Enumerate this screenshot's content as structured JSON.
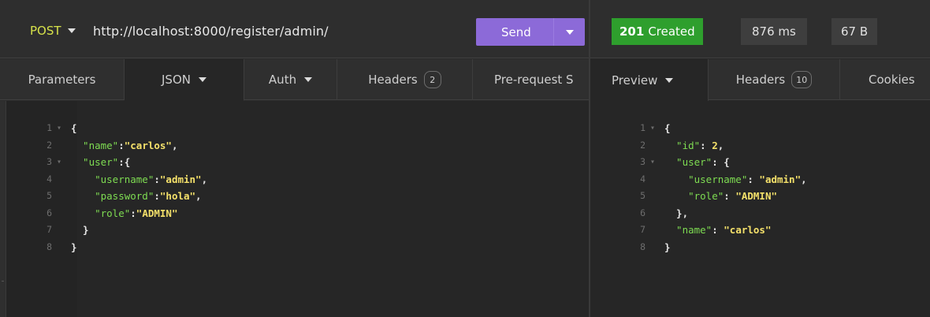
{
  "request": {
    "method": "POST",
    "url": "http://localhost:8000/register/admin/",
    "send_label": "Send",
    "tabs": [
      {
        "label": "Parameters"
      },
      {
        "label": "JSON"
      },
      {
        "label": "Auth"
      },
      {
        "label": "Headers",
        "badge": "2"
      },
      {
        "label": "Pre-request S"
      }
    ],
    "body_lines": [
      {
        "n": "1",
        "fold": true,
        "tokens": [
          [
            "p",
            "{"
          ]
        ]
      },
      {
        "n": "2",
        "fold": false,
        "tokens": [
          [
            "k",
            "  \"name\""
          ],
          [
            "p",
            ":"
          ],
          [
            "s",
            "\"carlos\""
          ],
          [
            "p",
            ","
          ]
        ]
      },
      {
        "n": "3",
        "fold": true,
        "tokens": [
          [
            "k",
            "  \"user\""
          ],
          [
            "p",
            ":{"
          ]
        ]
      },
      {
        "n": "4",
        "fold": false,
        "tokens": [
          [
            "k",
            "    \"username\""
          ],
          [
            "p",
            ":"
          ],
          [
            "s",
            "\"admin\""
          ],
          [
            "p",
            ","
          ]
        ]
      },
      {
        "n": "5",
        "fold": false,
        "tokens": [
          [
            "k",
            "    \"password\""
          ],
          [
            "p",
            ":"
          ],
          [
            "s",
            "\"hola\""
          ],
          [
            "p",
            ","
          ]
        ]
      },
      {
        "n": "6",
        "fold": false,
        "tokens": [
          [
            "k",
            "    \"role\""
          ],
          [
            "p",
            ":"
          ],
          [
            "s",
            "\"ADMIN\""
          ]
        ]
      },
      {
        "n": "7",
        "fold": false,
        "tokens": [
          [
            "p",
            "  }"
          ]
        ]
      },
      {
        "n": "8",
        "fold": false,
        "tokens": [
          [
            "p",
            "}"
          ]
        ]
      }
    ]
  },
  "response": {
    "status_code": "201",
    "status_text": "Created",
    "time": "876 ms",
    "size": "67 B",
    "tabs": [
      {
        "label": "Preview"
      },
      {
        "label": "Headers",
        "badge": "10"
      },
      {
        "label": "Cookies"
      }
    ],
    "body_lines": [
      {
        "n": "1",
        "fold": true,
        "tokens": [
          [
            "p",
            "{"
          ]
        ]
      },
      {
        "n": "2",
        "fold": false,
        "tokens": [
          [
            "k",
            "  \"id\""
          ],
          [
            "p",
            ": "
          ],
          [
            "n",
            "2"
          ],
          [
            "p",
            ","
          ]
        ]
      },
      {
        "n": "3",
        "fold": true,
        "tokens": [
          [
            "k",
            "  \"user\""
          ],
          [
            "p",
            ": {"
          ]
        ]
      },
      {
        "n": "4",
        "fold": false,
        "tokens": [
          [
            "k",
            "    \"username\""
          ],
          [
            "p",
            ": "
          ],
          [
            "s",
            "\"admin\""
          ],
          [
            "p",
            ","
          ]
        ]
      },
      {
        "n": "5",
        "fold": false,
        "tokens": [
          [
            "k",
            "    \"role\""
          ],
          [
            "p",
            ": "
          ],
          [
            "s",
            "\"ADMIN\""
          ]
        ]
      },
      {
        "n": "6",
        "fold": false,
        "tokens": [
          [
            "p",
            "  },"
          ]
        ]
      },
      {
        "n": "7",
        "fold": false,
        "tokens": [
          [
            "k",
            "  \"name\""
          ],
          [
            "p",
            ": "
          ],
          [
            "s",
            "\"carlos\""
          ]
        ]
      },
      {
        "n": "8",
        "fold": false,
        "tokens": [
          [
            "p",
            "}"
          ]
        ]
      }
    ]
  },
  "colors": {
    "send": "#8c6ad8",
    "status_ok": "#2e9f2d",
    "method": "#d7e24a",
    "json_key": "#7edc52",
    "json_string": "#f4e06a"
  }
}
